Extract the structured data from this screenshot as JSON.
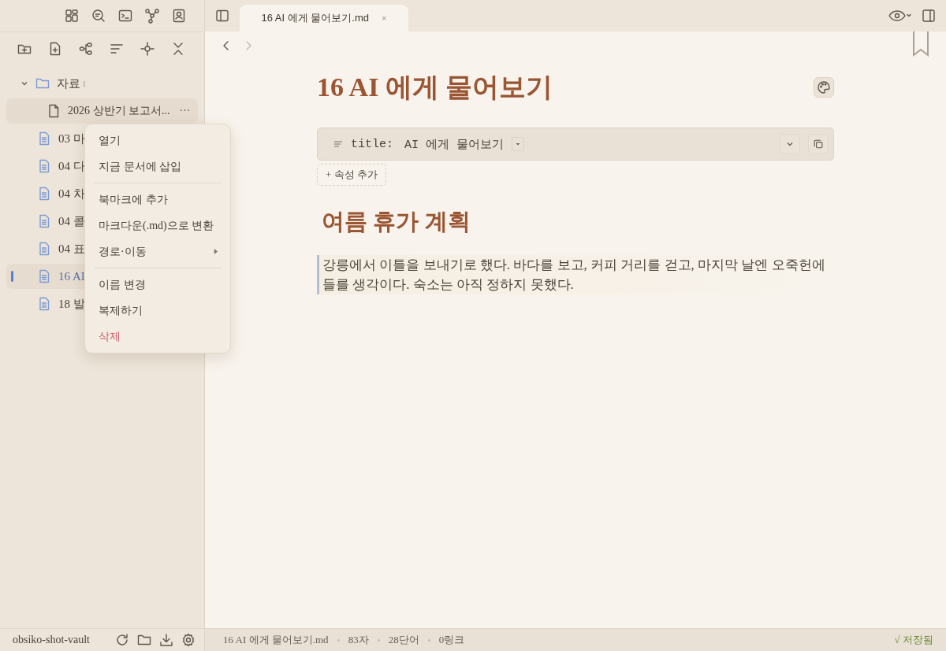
{
  "sidebar": {
    "tree": {
      "label": "자료",
      "count": "1",
      "expanded": true,
      "children": [
        {
          "label": "2026 상반기 보고서...",
          "kind": "pdf",
          "selected": false,
          "hovered": true,
          "more": "···"
        },
        {
          "label": "03 마",
          "kind": "note",
          "selected": false,
          "hovered": false
        },
        {
          "label": "04 다",
          "kind": "note",
          "selected": false,
          "hovered": false
        },
        {
          "label": "04 차",
          "kind": "note",
          "selected": false,
          "hovered": false
        },
        {
          "label": "04 콜",
          "kind": "note",
          "selected": false,
          "hovered": false
        },
        {
          "label": "04 표",
          "kind": "note",
          "selected": false,
          "hovered": false
        },
        {
          "label": "16 AI",
          "kind": "note",
          "selected": true,
          "hovered": false
        },
        {
          "label": "18 발",
          "kind": "note",
          "selected": false,
          "hovered": false
        }
      ]
    },
    "vault_name": "obsiko-shot-vault"
  },
  "context_menu": [
    {
      "kind": "item",
      "label": "열기"
    },
    {
      "kind": "item",
      "label": "지금 문서에 삽입"
    },
    {
      "kind": "separator"
    },
    {
      "kind": "item",
      "label": "북마크에 추가"
    },
    {
      "kind": "item",
      "label": "마크다운(.md)으로 변환"
    },
    {
      "kind": "submenu",
      "label": "경로·이동"
    },
    {
      "kind": "separator"
    },
    {
      "kind": "item",
      "label": "이름 변경"
    },
    {
      "kind": "item",
      "label": "복제하기"
    },
    {
      "kind": "danger",
      "label": "삭제"
    }
  ],
  "tabs": [
    {
      "label": "16 AI 에게 물어보기.md",
      "close": "×",
      "selected": true
    }
  ],
  "document": {
    "title": "16 AI 에게 물어보기",
    "properties": [
      {
        "key": "title:",
        "value": "AI 에게 물어보기"
      }
    ],
    "add_property": "+ 속성 추가",
    "heading": "여름 휴가 계획",
    "paragraph": "강릉에서 이틀을 보내기로 했다. 바다를 보고, 커피 거리를 걷고, 마지막 날엔 오죽헌에 들를 생각이다. 숙소는 아직 정하지 못했다."
  },
  "status_bar": {
    "file": "16 AI 에게 물어보기.md",
    "chars": "83자",
    "words": "28단어",
    "links": "0링크",
    "saved": "√ 저장됨"
  }
}
